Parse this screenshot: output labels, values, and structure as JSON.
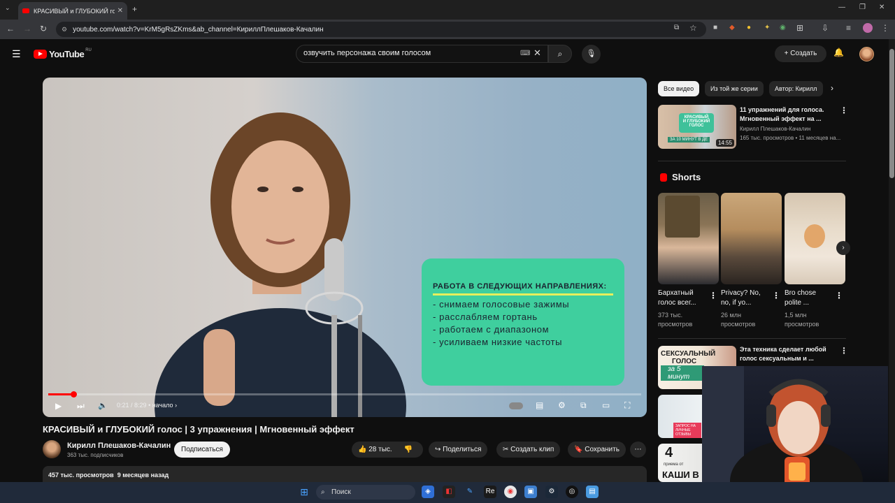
{
  "browser": {
    "tab_title": "КРАСИВЫЙ и ГЛУБОКИЙ голос",
    "url": "youtube.com/watch?v=KrM5gRsZKms&ab_channel=КириллПлешаков-Качалин"
  },
  "youtube": {
    "logo_text": "YouTube",
    "logo_region": "RU",
    "search_value": "озвучить персонажа своим голосом",
    "create_label": "Создать"
  },
  "player": {
    "progress_fraction": 0.042,
    "time": "0:21 / 8:29",
    "chapter": "• начало",
    "overlay": {
      "heading": "РАБОТА В СЛЕДУЮЩИХ НАПРАВЛЕНИЯХ:",
      "items": [
        "- снимаем голосовые зажимы",
        "- расслабляем гортань",
        "- работаем с диапазоном",
        "- усиливаем низкие частоты"
      ]
    }
  },
  "video": {
    "title": "КРАСИВЫЙ и ГЛУБОКИЙ голос | 3 упражнения | Мгновенный эффект",
    "channel": "Кирилл Плешаков-Качалин",
    "subscribers": "363 тыс. подписчиков",
    "subscribe_label": "Подписаться",
    "likes": "28 тыс.",
    "share_label": "Поделиться",
    "clip_label": "Создать клип",
    "save_label": "Сохранить",
    "views": "457 тыс. просмотров",
    "age": "9 месяцев назад"
  },
  "sidebar": {
    "chips": [
      "Все видео",
      "Из той же серии",
      "Автор: Кирилл"
    ],
    "rec": {
      "title": "11 упражнений для голоса. Мгновенный эффект на ...",
      "channel": "Кирилл Плешаков-Качалин",
      "meta": "165 тыс. просмотров • 11 месяцев на...",
      "duration": "14:55",
      "badge_l1": "КРАСИВЫЙ",
      "badge_l2": "И ГЛУБОКИЙ",
      "badge_l3": "ГОЛОС",
      "badge_bottom": "ЗА 10 МИНУТ В ДЕ"
    },
    "shorts_heading": "Shorts",
    "shorts": [
      {
        "title": "Бархатный голос всег...",
        "views_l1": "373 тыс.",
        "views_l2": "просмотров"
      },
      {
        "title": "Privacy? No, no, if yo...",
        "views_l1": "26 млн",
        "views_l2": "просмотров"
      },
      {
        "title": "Bro chose polite ...",
        "views_l1": "1,5 млн",
        "views_l2": "просмотров"
      }
    ],
    "rec2": {
      "title": "Эта техника сделает любой голос сексуальным и ...",
      "thumb_l1": "СЕКСУАЛЬНЫЙ",
      "thumb_l2": "ГОЛОС",
      "thumb_l3": "за 5 минут"
    },
    "rec3": {
      "thumb_text": "ЗАПРОС НА ЛИЧНЫЕ ОТЗЫВЫ"
    },
    "rec4": {
      "thumb_num": "4",
      "thumb_sub": "приема от",
      "thumb_big": "КАШИ В"
    }
  },
  "taskbar": {
    "search_label": "Поиск"
  },
  "colors": {
    "accent": "#ff0000",
    "overlay_green": "#3fcf9e",
    "background": "#0f0f0f"
  }
}
